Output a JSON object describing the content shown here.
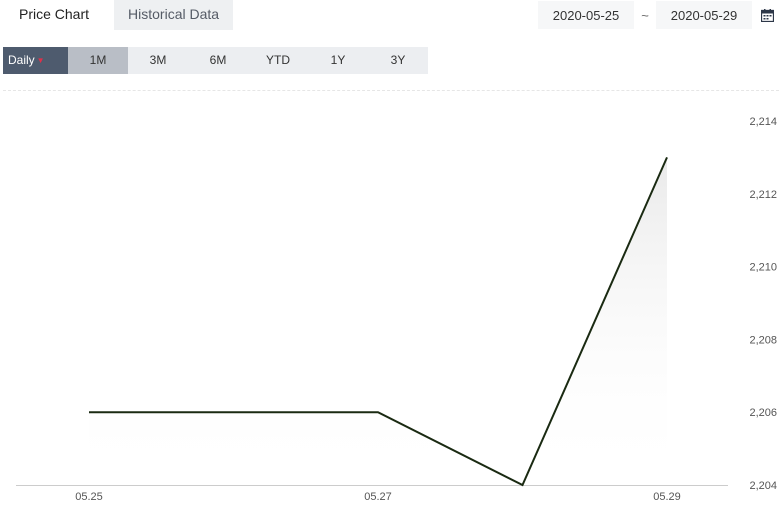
{
  "tabs": [
    {
      "label": "Price Chart",
      "active": true
    },
    {
      "label": "Historical Data",
      "active": false
    }
  ],
  "date_range": {
    "start": "2020-05-25",
    "separator": "~",
    "end": "2020-05-29"
  },
  "periods": {
    "daily_label": "Daily",
    "ranges": [
      {
        "label": "1M",
        "selected": true
      },
      {
        "label": "3M",
        "selected": false
      },
      {
        "label": "6M",
        "selected": false
      },
      {
        "label": "YTD",
        "selected": false
      },
      {
        "label": "1Y",
        "selected": false
      },
      {
        "label": "3Y",
        "selected": false
      }
    ]
  },
  "colors": {
    "line": "#1a2a12",
    "daily_bg": "#4e5b6e",
    "selected_bg": "#b9bec6",
    "caret": "#e0304a"
  },
  "chart_data": {
    "type": "line",
    "x": [
      "05.25",
      "05.26",
      "05.27",
      "05.28",
      "05.29"
    ],
    "values": [
      2206,
      2206,
      2206,
      2204,
      2213
    ],
    "x_tick_labels": [
      "05.25",
      "05.27",
      "05.29"
    ],
    "y_tick_labels": [
      "2,204",
      "2,206",
      "2,208",
      "2,210",
      "2,212",
      "2,214"
    ],
    "y_ticks": [
      2204,
      2206,
      2208,
      2210,
      2212,
      2214
    ],
    "ylim": [
      2204,
      2214
    ],
    "y_axis_position": "right",
    "grid": false
  }
}
